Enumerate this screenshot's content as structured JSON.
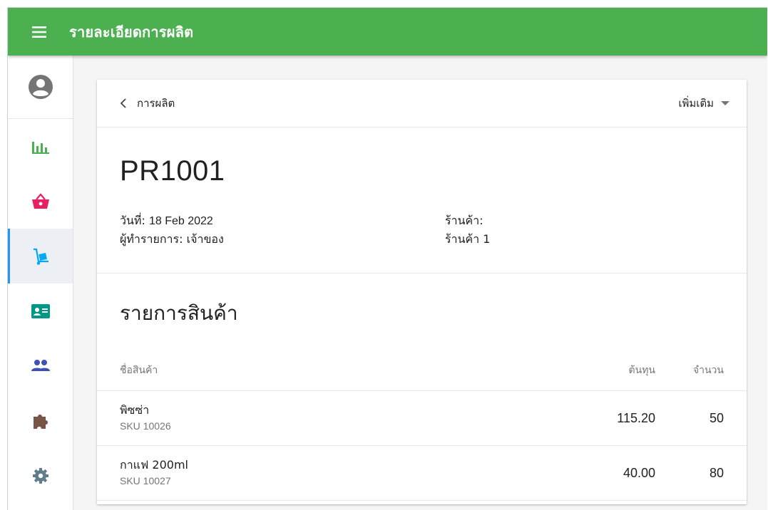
{
  "appbar": {
    "title": "รายละเอียดการผลิต",
    "color": "#4caf50"
  },
  "sidebar": {
    "items": [
      {
        "name": "reports",
        "icon": "bar-chart-icon",
        "color": "#4caf50"
      },
      {
        "name": "sales",
        "icon": "basket-icon",
        "color": "#e91e63"
      },
      {
        "name": "production",
        "icon": "hand-truck-icon",
        "color": "#03a9f4",
        "active": true
      },
      {
        "name": "contacts",
        "icon": "contact-card-icon",
        "color": "#009688"
      },
      {
        "name": "users",
        "icon": "people-icon",
        "color": "#3f51b5"
      },
      {
        "name": "addons",
        "icon": "puzzle-icon",
        "color": "#795548"
      },
      {
        "name": "settings",
        "icon": "gear-icon",
        "color": "#607d8b"
      }
    ]
  },
  "header": {
    "back_label": "การผลิต",
    "more_label": "เพิ่มเติม"
  },
  "document": {
    "number": "PR1001",
    "date_label": "วันที่:",
    "date_value": "18 Feb 2022",
    "creator_label": "ผู้ทำรายการ:",
    "creator_value": "เจ้าของ",
    "store_label": "ร้านค้า:",
    "store_value": "ร้านค้า 1"
  },
  "items": {
    "title": "รายการสินค้า",
    "columns": {
      "name": "ชื่อสินค้า",
      "cost": "ต้นทุน",
      "qty": "จำนวน"
    },
    "rows": [
      {
        "name": "พิซซ่า",
        "sku": "SKU 10026",
        "cost": "115.20",
        "qty": "50"
      },
      {
        "name": "กาแฟ 200ml",
        "sku": "SKU 10027",
        "cost": "40.00",
        "qty": "80"
      }
    ]
  }
}
